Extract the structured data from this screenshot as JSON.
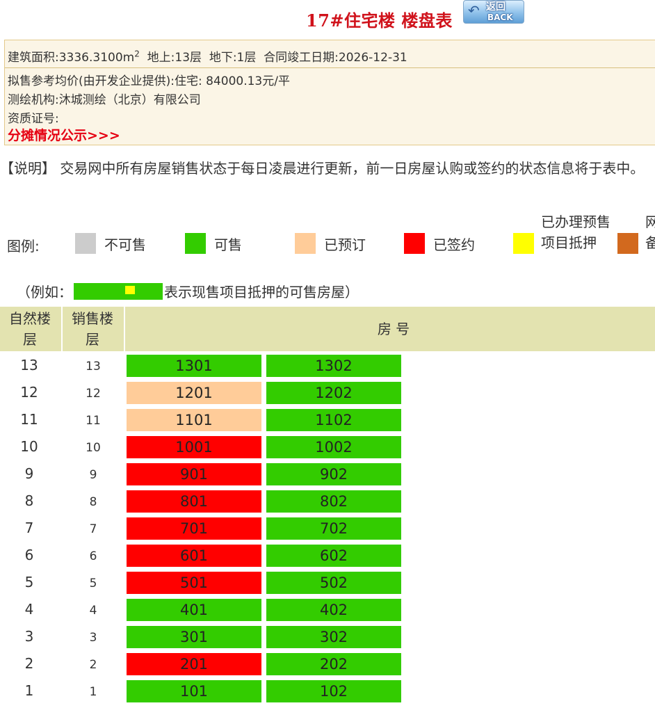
{
  "header": {
    "title": "17#住宅楼 楼盘表",
    "back_cn": "返回",
    "back_en": "BACK"
  },
  "info": {
    "area_prefix": "建筑面积:3336.3100m",
    "area_sup": "2",
    "area_rest": "  地上:13层  地下:1层  合同竣工日期:2026-12-31",
    "price": "拟售参考均价(由开发企业提供):住宅:  84000.13元/平",
    "surveyor": "测绘机构:沐城测绘（北京）有限公司",
    "cert": "资质证号:",
    "share_link": "分摊情况公示>>>"
  },
  "note": "【说明】 交易网中所有房屋销售状态于每日凌晨进行更新，前一日房屋认购或签约的状态信息将于表中。",
  "legend": {
    "label": "图例:",
    "items": [
      {
        "text": "不可售",
        "color": "#cccccc"
      },
      {
        "text": "可售",
        "color": "#33cc00"
      },
      {
        "text": "已预订",
        "color": "#ffcc99"
      },
      {
        "text": "已签约",
        "color": "#ff0000"
      },
      {
        "text": "已办理预售项目抵押",
        "color": "#ffff00"
      },
      {
        "text": "网备",
        "color": "#d2691e"
      }
    ]
  },
  "example": {
    "prefix": "（例如：",
    "suffix": "表示现售项目抵押的可售房屋）"
  },
  "table": {
    "col_natural": "自然楼层",
    "col_sales": "销售楼层",
    "col_room": "房 号",
    "status_colors": {
      "available": "#33cc00",
      "reserved": "#ffcc99",
      "signed": "#ff0000"
    },
    "rows": [
      {
        "floor": "13",
        "sales": "13",
        "units": [
          {
            "no": "1301",
            "status": "available"
          },
          {
            "no": "1302",
            "status": "available"
          }
        ]
      },
      {
        "floor": "12",
        "sales": "12",
        "units": [
          {
            "no": "1201",
            "status": "reserved"
          },
          {
            "no": "1202",
            "status": "available"
          }
        ]
      },
      {
        "floor": "11",
        "sales": "11",
        "units": [
          {
            "no": "1101",
            "status": "reserved"
          },
          {
            "no": "1102",
            "status": "available"
          }
        ]
      },
      {
        "floor": "10",
        "sales": "10",
        "units": [
          {
            "no": "1001",
            "status": "signed"
          },
          {
            "no": "1002",
            "status": "available"
          }
        ]
      },
      {
        "floor": "9",
        "sales": "9",
        "units": [
          {
            "no": "901",
            "status": "signed"
          },
          {
            "no": "902",
            "status": "available"
          }
        ]
      },
      {
        "floor": "8",
        "sales": "8",
        "units": [
          {
            "no": "801",
            "status": "signed"
          },
          {
            "no": "802",
            "status": "available"
          }
        ]
      },
      {
        "floor": "7",
        "sales": "7",
        "units": [
          {
            "no": "701",
            "status": "signed"
          },
          {
            "no": "702",
            "status": "available"
          }
        ]
      },
      {
        "floor": "6",
        "sales": "6",
        "units": [
          {
            "no": "601",
            "status": "signed"
          },
          {
            "no": "602",
            "status": "available"
          }
        ]
      },
      {
        "floor": "5",
        "sales": "5",
        "units": [
          {
            "no": "501",
            "status": "signed"
          },
          {
            "no": "502",
            "status": "available"
          }
        ]
      },
      {
        "floor": "4",
        "sales": "4",
        "units": [
          {
            "no": "401",
            "status": "available"
          },
          {
            "no": "402",
            "status": "available"
          }
        ]
      },
      {
        "floor": "3",
        "sales": "3",
        "units": [
          {
            "no": "301",
            "status": "available"
          },
          {
            "no": "302",
            "status": "available"
          }
        ]
      },
      {
        "floor": "2",
        "sales": "2",
        "units": [
          {
            "no": "201",
            "status": "signed"
          },
          {
            "no": "202",
            "status": "available"
          }
        ]
      },
      {
        "floor": "1",
        "sales": "1",
        "units": [
          {
            "no": "101",
            "status": "available"
          },
          {
            "no": "102",
            "status": "available"
          }
        ]
      }
    ]
  }
}
